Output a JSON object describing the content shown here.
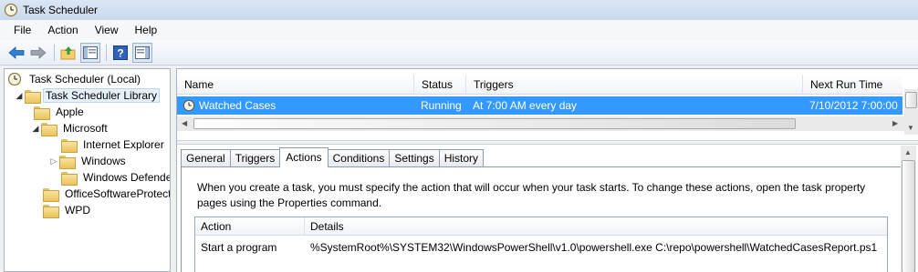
{
  "window": {
    "title": "Task Scheduler"
  },
  "menu": [
    "File",
    "Action",
    "View",
    "Help"
  ],
  "toolbar": {
    "buttons": [
      "back-arrow-icon",
      "forward-arrow-icon",
      "up-folder-icon",
      "show-hide-tree-icon",
      "help-icon",
      "show-hide-action-pane-icon"
    ]
  },
  "tree": {
    "root": "Task Scheduler (Local)",
    "library": "Task Scheduler Library",
    "apple": "Apple",
    "microsoft": "Microsoft",
    "internet_explorer": "Internet Explorer",
    "windows": "Windows",
    "windows_defender": "Windows Defende",
    "office_software_protection": "OfficeSoftwareProtect",
    "wpd": "WPD"
  },
  "task_list": {
    "columns": {
      "name": "Name",
      "status": "Status",
      "triggers": "Triggers",
      "next_run": "Next Run Time"
    },
    "rows": [
      {
        "name": "Watched Cases",
        "status": "Running",
        "triggers": "At 7:00 AM every day",
        "next_run": "7/10/2012 7:00:00"
      }
    ]
  },
  "tabs": {
    "general": "General",
    "triggers": "Triggers",
    "actions": "Actions",
    "conditions": "Conditions",
    "settings": "Settings",
    "history": "History",
    "active": "Actions"
  },
  "actions_tab": {
    "description": "When you create a task, you must specify the action that will occur when your task starts.  To change these actions, open the task property pages using the Properties command.",
    "columns": {
      "action": "Action",
      "details": "Details"
    },
    "rows": [
      {
        "action": "Start a program",
        "details": "%SystemRoot%\\SYSTEM32\\WindowsPowerShell\\v1.0\\powershell.exe C:\\repo\\powershell\\WatchedCasesReport.ps1"
      }
    ]
  },
  "colors": {
    "selection": "#3399ff",
    "selection_text": "#ffffff",
    "title_bar": "#c9d9ee"
  }
}
